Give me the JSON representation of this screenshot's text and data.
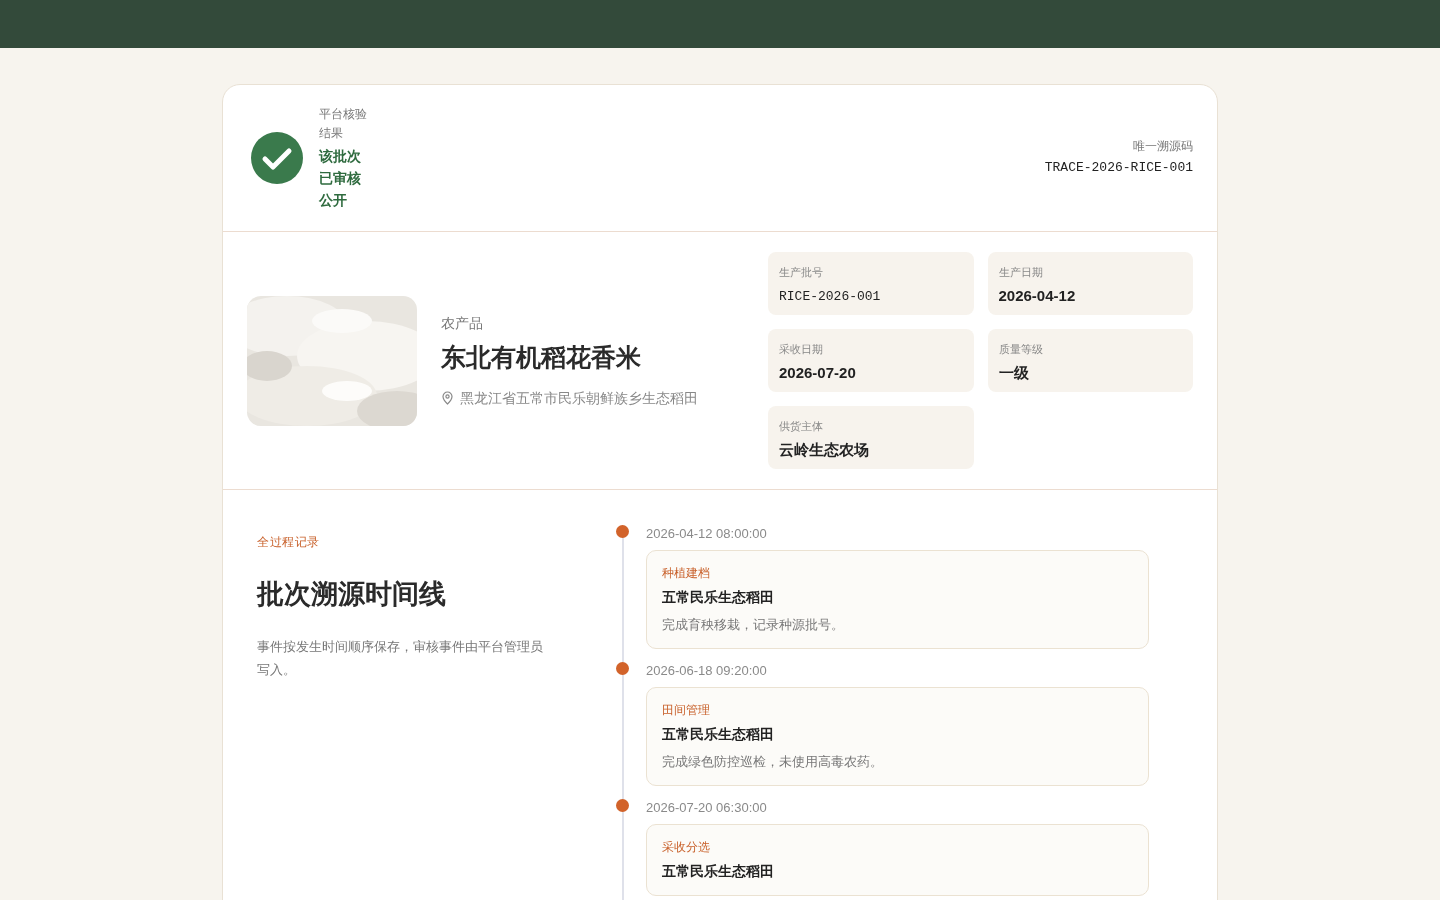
{
  "verification": {
    "label": "平台核验结果",
    "status": "该批次已审核公开",
    "verified": true
  },
  "trace_code": {
    "label": "唯一溯源码",
    "value": "TRACE-2026-RICE-001"
  },
  "product": {
    "category": "农产品",
    "name": "东北有机稻花香米",
    "origin": "黑龙江省五常市民乐朝鲜族乡生态稻田"
  },
  "facts": [
    {
      "label": "生产批号",
      "value": "RICE-2026-001",
      "kind": "code"
    },
    {
      "label": "生产日期",
      "value": "2026-04-12",
      "kind": "text"
    },
    {
      "label": "采收日期",
      "value": "2026-07-20",
      "kind": "text"
    },
    {
      "label": "质量等级",
      "value": "一级",
      "kind": "text"
    },
    {
      "label": "供货主体",
      "value": "云岭生态农场",
      "kind": "text"
    }
  ],
  "timeline_intro": {
    "eyebrow": "全过程记录",
    "title": "批次溯源时间线",
    "description": "事件按发生时间顺序保存，审核事件由平台管理员写入。"
  },
  "events": [
    {
      "time": "2026-04-12 08:00:00",
      "type": "种植建档",
      "place": "五常民乐生态稻田",
      "note": "完成育秧移栽，记录种源批号。"
    },
    {
      "time": "2026-06-18 09:20:00",
      "type": "田间管理",
      "place": "五常民乐生态稻田",
      "note": "完成绿色防控巡检，未使用高毒农药。"
    },
    {
      "time": "2026-07-20 06:30:00",
      "type": "采收分选",
      "place": "五常民乐生态稻田"
    }
  ]
}
